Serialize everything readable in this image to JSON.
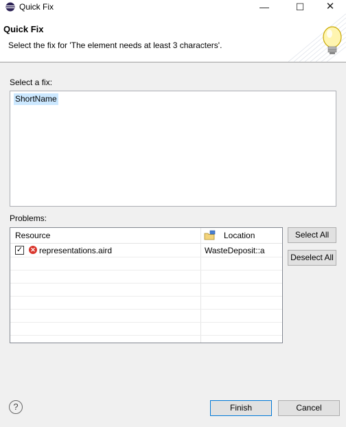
{
  "window": {
    "title": "Quick Fix",
    "controls": {
      "minimize": "—",
      "maximize": "☐",
      "close": "✕"
    }
  },
  "header": {
    "title": "Quick Fix",
    "message": "Select the fix for 'The element needs at least 3 characters'."
  },
  "fixes": {
    "label": "Select a fix:",
    "items": [
      {
        "label": "ShortName",
        "selected": true
      }
    ]
  },
  "problems": {
    "label": "Problems:",
    "columns": {
      "resource": "Resource",
      "location": "Location"
    },
    "rows": [
      {
        "checked": true,
        "resource": "representations.aird",
        "location": "WasteDeposit::a"
      }
    ]
  },
  "buttons": {
    "select_all": "Select All",
    "deselect_all": "Deselect All",
    "finish": "Finish",
    "cancel": "Cancel",
    "help": "?"
  },
  "colors": {
    "selection": "#cce8ff",
    "error": "#d9352c",
    "default_button_border": "#0078d7"
  }
}
